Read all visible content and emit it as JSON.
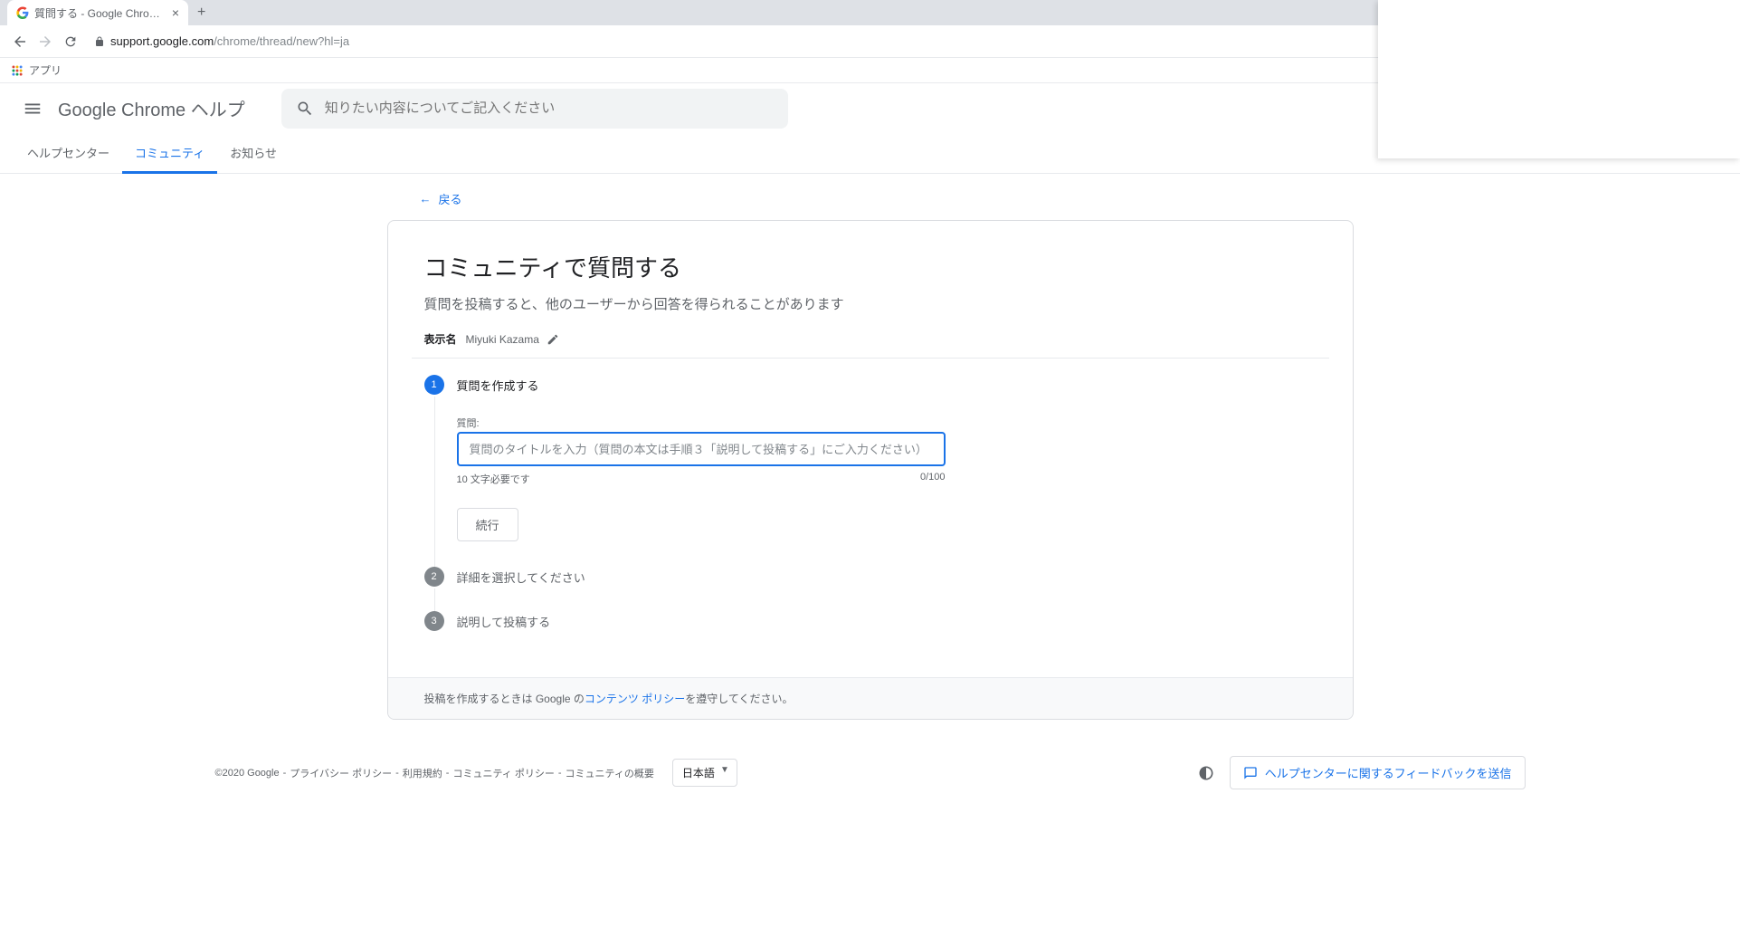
{
  "browser": {
    "tab_title": "質問する - Google Chrome Comm",
    "url_host": "support.google.com",
    "url_path": "/chrome/thread/new?hl=ja",
    "apps_label": "アプリ"
  },
  "header": {
    "product": "Google Chrome ヘルプ",
    "search_placeholder": "知りたい内容についてご記入ください"
  },
  "tabs": {
    "help_center": "ヘルプセンター",
    "community": "コミュニティ",
    "announcements": "お知らせ"
  },
  "back_label": "戻る",
  "card": {
    "title": "コミュニティで質問する",
    "subtitle": "質問を投稿すると、他のユーザーから回答を得られることがあります",
    "display_label": "表示名",
    "display_name": "Miyuki Kazama"
  },
  "steps": {
    "s1": {
      "num": "1",
      "title": "質問を作成する"
    },
    "s2": {
      "num": "2",
      "title": "詳細を選択してください"
    },
    "s3": {
      "num": "3",
      "title": "説明して投稿する"
    }
  },
  "field": {
    "label": "質問:",
    "placeholder": "質問のタイトルを入力（質問の本文は手順３「説明して投稿する」にご入力ください）",
    "helper_left": "10 文字必要です",
    "helper_right": "0/100"
  },
  "continue_label": "続行",
  "policy": {
    "prefix": "投稿を作成するときは Google の",
    "link": "コンテンツ ポリシー",
    "suffix": "を遵守してください。"
  },
  "footer": {
    "copyright": "©2020 Google",
    "links": {
      "privacy": "プライバシー ポリシー",
      "terms": "利用規約",
      "community_policy": "コミュニティ ポリシー",
      "community_overview": "コミュニティの概要"
    },
    "sep": " - ",
    "language": "日本語",
    "feedback": "ヘルプセンターに関するフィードバックを送信"
  }
}
